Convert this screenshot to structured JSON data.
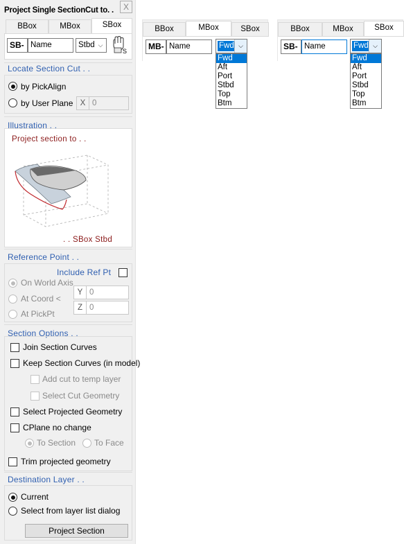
{
  "dialog": {
    "title": "Project Single SectionCut to. .",
    "close_label": "X",
    "tabs": [
      "BBox",
      "MBox",
      "SBox"
    ],
    "prefix": "SB-",
    "name_value": "Name",
    "side_value": "Stbd",
    "tool_icon": "hand-pick-icon",
    "tool_letter": "S"
  },
  "locate": {
    "title": "Locate Section Cut . .",
    "by_pickalign": "by PickAlign",
    "by_user_plane": "by User Plane",
    "axis_key": "X",
    "axis_value": "0"
  },
  "illustration": {
    "title": "Illustration . .",
    "top_text": "Project section to . .",
    "bottom_text": ". . SBox Stbd"
  },
  "reference": {
    "title": "Reference Point . .",
    "include_label": "Include Ref Pt",
    "on_world_axis": "On World Axis",
    "at_coord": "At Coord <",
    "at_pickpt": "At PickPt",
    "y_key": "Y",
    "y_value": "0",
    "z_key": "Z",
    "z_value": "0"
  },
  "options": {
    "title": "Section Options . .",
    "join_curves": "Join Section Curves",
    "keep_curves": "Keep Section Curves (in model)",
    "add_cut_temp": "Add cut to temp layer",
    "select_cut_geom": "Select Cut Geometry",
    "select_projected": "Select Projected Geometry",
    "cplane_no_change": "CPlane no change",
    "to_section": "To Section",
    "to_face": "To Face",
    "trim_projected": "Trim projected geometry"
  },
  "destination": {
    "title": "Destination Layer . .",
    "current": "Current",
    "select_from_list": "Select from layer list dialog",
    "project_button": "Project Section"
  },
  "preview_mbox": {
    "tabs": [
      "BBox",
      "MBox",
      "SBox"
    ],
    "prefix": "MB-",
    "name_value": "Name",
    "selected": "Fwd",
    "options": [
      "Fwd",
      "Aft",
      "Port",
      "Stbd",
      "Top",
      "Btm"
    ]
  },
  "preview_sbox": {
    "tabs": [
      "BBox",
      "MBox",
      "SBox"
    ],
    "prefix": "SB-",
    "name_value": "Name",
    "selected": "Fwd",
    "options": [
      "Fwd",
      "Aft",
      "Port",
      "Stbd",
      "Top",
      "Btm"
    ]
  },
  "colors": {
    "section_title": "#2f5fb0",
    "illustration_text": "#8b1a1a",
    "dropdown_highlight": "#0078d7"
  }
}
